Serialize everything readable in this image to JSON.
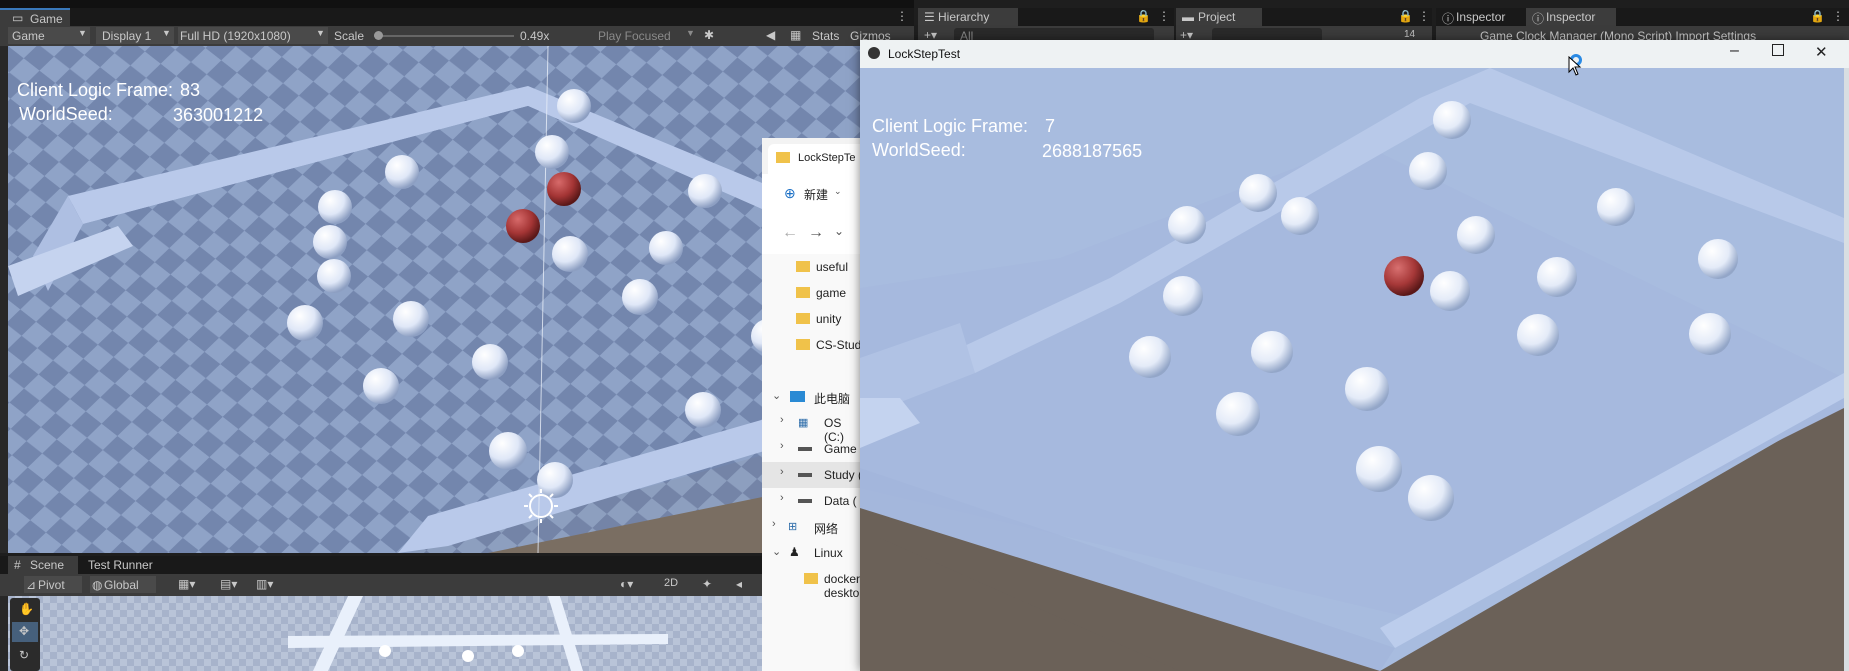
{
  "game_panel": {
    "tab_label": "Game",
    "toolbar": {
      "mode": "Game",
      "display": "Display 1",
      "resolution": "Full HD (1920x1080)",
      "scale_label": "Scale",
      "scale_value": "0.49x",
      "play_focused": "Play Focused",
      "stats": "Stats",
      "gizmos": "Gizmos"
    },
    "overlay": {
      "frame_label": "Client Logic Frame:",
      "frame_value": "83",
      "seed_label": "WorldSeed:",
      "seed_value": "363001212"
    }
  },
  "scene_panel": {
    "tabs": [
      "Scene",
      "Test Runner"
    ],
    "pivot": "Pivot",
    "global": "Global",
    "mode_2d": "2D"
  },
  "dock_tabs": {
    "hierarchy": "Hierarchy",
    "hierarchy_search": "All",
    "project": "Project",
    "inspector_1": "Inspector",
    "inspector_2": "Inspector",
    "inspector_subtitle": "Game Clock Manager (Mono Script) Import Settings",
    "project_count": "14"
  },
  "explorer": {
    "tab_title": "LockStepTe",
    "new_button": "新建",
    "items": [
      {
        "label": "useful",
        "kind": "folder"
      },
      {
        "label": "game",
        "kind": "folder"
      },
      {
        "label": "unity",
        "kind": "folder"
      },
      {
        "label": "CS-Stud",
        "kind": "folder"
      },
      {
        "label": "此电脑",
        "kind": "pc"
      },
      {
        "label": "OS (C:)",
        "kind": "drive"
      },
      {
        "label": "Game",
        "kind": "drive"
      },
      {
        "label": "Study (",
        "kind": "drive"
      },
      {
        "label": "Data (",
        "kind": "drive"
      },
      {
        "label": "网络",
        "kind": "network"
      },
      {
        "label": "Linux",
        "kind": "linux"
      },
      {
        "label": "docker-desktop",
        "kind": "folder"
      }
    ]
  },
  "lockstep_window": {
    "title": "LockStepTest",
    "overlay": {
      "frame_label": "Client Logic Frame:",
      "frame_value": "7",
      "seed_label": "WorldSeed:",
      "seed_value": "2688187565"
    }
  },
  "colors": {
    "ball_white": "#e6eefa",
    "ball_red": "#a03232",
    "floor_blue": "#a8bce0",
    "ground": "#6b6158"
  }
}
